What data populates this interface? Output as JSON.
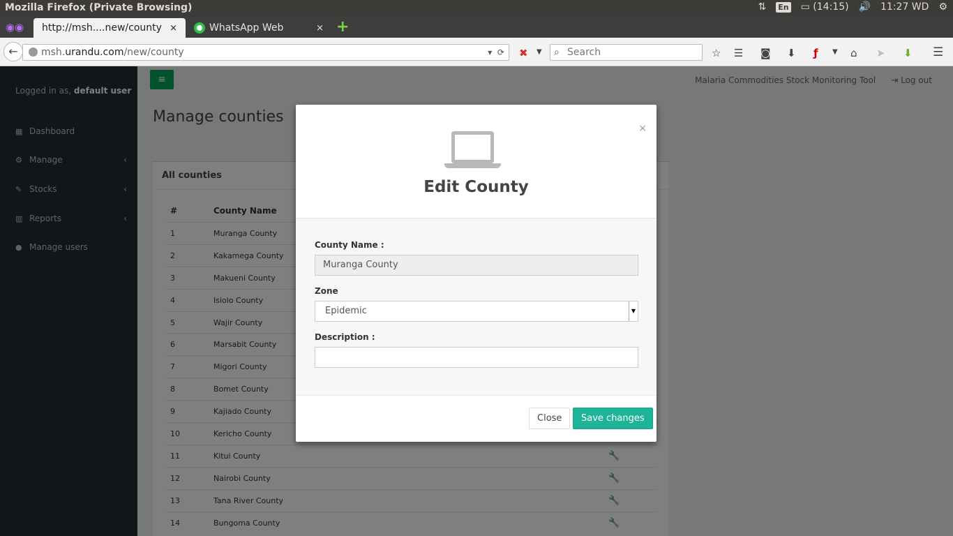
{
  "os_panel": {
    "window_title": "Mozilla Firefox (Private Browsing)",
    "lang": "En",
    "battery": "(14:15)",
    "clock": "11:27 WD"
  },
  "browser": {
    "tabs": [
      {
        "label": "http://msh....new/county",
        "close": "×"
      },
      {
        "label": "WhatsApp Web",
        "close": "×"
      }
    ],
    "url_prefix": "msh.",
    "url_domain": "urandu.com",
    "url_path": "/new/county",
    "search_placeholder": "Search"
  },
  "app": {
    "logged_in_prefix": "Logged in as,",
    "user": "default user",
    "sidebar": [
      {
        "label": "Dashboard",
        "icon": "dashboard-icon",
        "has_chevron": false
      },
      {
        "label": "Manage",
        "icon": "manage-icon",
        "has_chevron": true
      },
      {
        "label": "Stocks",
        "icon": "stocks-icon",
        "has_chevron": true
      },
      {
        "label": "Reports",
        "icon": "reports-icon",
        "has_chevron": true
      },
      {
        "label": "Manage users",
        "icon": "user-icon",
        "has_chevron": false
      }
    ],
    "header_title": "Malaria Commodities Stock Monitoring Tool",
    "logout": "Log out",
    "page_title": "Manage counties",
    "box_title": "All counties",
    "table": {
      "headers": [
        "#",
        "County Name"
      ],
      "rows": [
        [
          "1",
          "Muranga County"
        ],
        [
          "2",
          "Kakamega County"
        ],
        [
          "3",
          "Makueni County"
        ],
        [
          "4",
          "Isiolo County"
        ],
        [
          "5",
          "Wajir County"
        ],
        [
          "6",
          "Marsabit County"
        ],
        [
          "7",
          "Migori County"
        ],
        [
          "8",
          "Bomet County"
        ],
        [
          "9",
          "Kajiado County"
        ],
        [
          "10",
          "Kericho County"
        ],
        [
          "11",
          "Kitui County"
        ],
        [
          "12",
          "Nairobi County"
        ],
        [
          "13",
          "Tana River County"
        ],
        [
          "14",
          "Bungoma County"
        ]
      ]
    }
  },
  "modal": {
    "title": "Edit County",
    "close_x": "×",
    "county_label": "County Name :",
    "county_value": "Muranga County",
    "zone_label": "Zone",
    "zone_value": "Epidemic",
    "description_label": "Description :",
    "description_value": "",
    "close_button": "Close",
    "save_button": "Save changes"
  },
  "colors": {
    "sidebar_bg": "#222d32",
    "accent_green": "#00a65a",
    "save_button": "#1fb398"
  }
}
